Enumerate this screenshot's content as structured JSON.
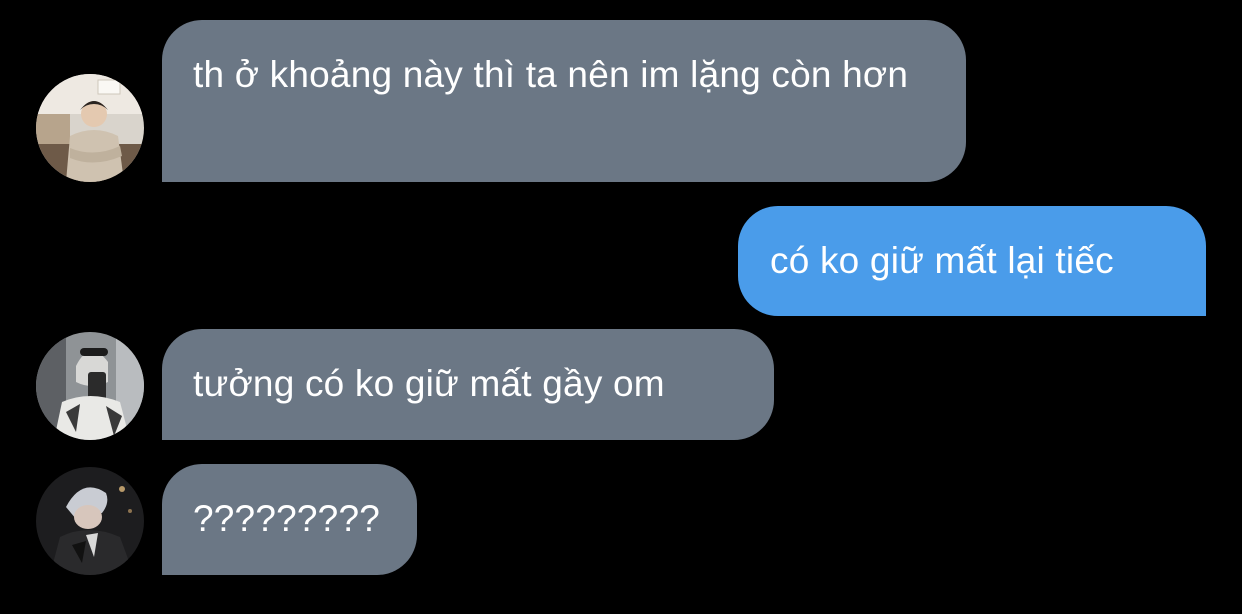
{
  "messages": [
    {
      "sender": "other",
      "avatar": "avatar-1",
      "text": "th ở khoảng này thì ta nên im lặng còn hơn"
    },
    {
      "sender": "me",
      "text": "có ko giữ mất lại tiếc"
    },
    {
      "sender": "other",
      "avatar": "avatar-2",
      "text": "tưởng có ko giữ mất gầy om"
    },
    {
      "sender": "other",
      "avatar": "avatar-3",
      "text": "?????????"
    }
  ],
  "colors": {
    "background": "#000000",
    "incoming_bubble": "#6b7785",
    "outgoing_bubble": "#4a9cea",
    "text": "#ffffff"
  }
}
